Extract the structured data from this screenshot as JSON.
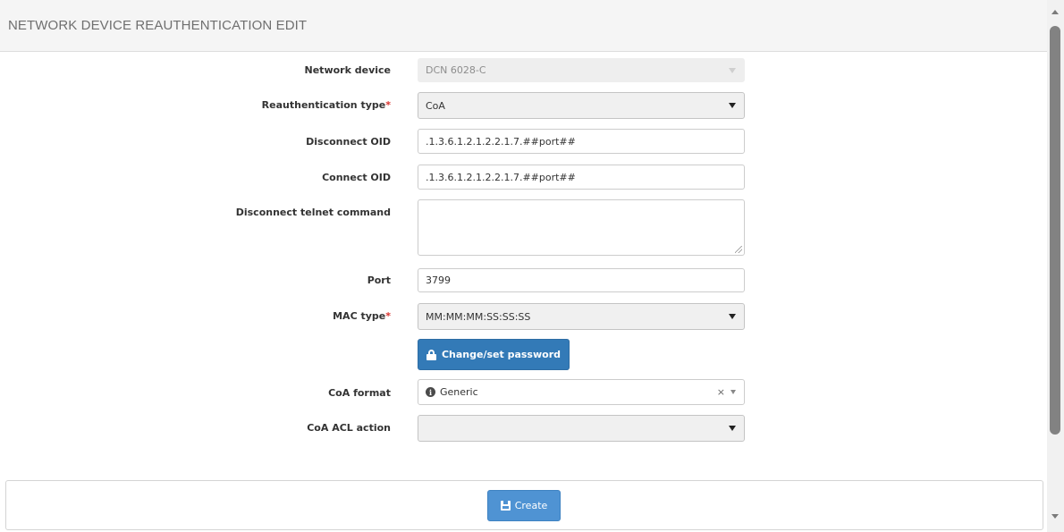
{
  "header": {
    "title": "NETWORK DEVICE REAUTHENTICATION EDIT"
  },
  "form": {
    "network_device": {
      "label": "Network device",
      "value": "DCN 6028-C"
    },
    "reauth_type": {
      "label": "Reauthentication type",
      "required": "*",
      "value": "CoA"
    },
    "disconnect_oid": {
      "label": "Disconnect OID",
      "value": ".1.3.6.1.2.1.2.2.1.7.##port##"
    },
    "connect_oid": {
      "label": "Connect OID",
      "value": ".1.3.6.1.2.1.2.2.1.7.##port##"
    },
    "disconnect_telnet": {
      "label": "Disconnect telnet command",
      "value": ""
    },
    "port": {
      "label": "Port",
      "value": "3799"
    },
    "mac_type": {
      "label": "MAC type",
      "required": "*",
      "value": "MM:MM:MM:SS:SS:SS"
    },
    "change_password": {
      "label": "Change/set password"
    },
    "coa_format": {
      "label": "CoA format",
      "value": "Generic",
      "clear": "×",
      "info_glyph": "i"
    },
    "coa_acl_action": {
      "label": "CoA ACL action",
      "value": ""
    }
  },
  "footer": {
    "create_label": "Create"
  },
  "icons": {
    "lock": "lock-icon",
    "info": "info-icon",
    "save": "save-icon",
    "caret": "caret-down-icon"
  }
}
